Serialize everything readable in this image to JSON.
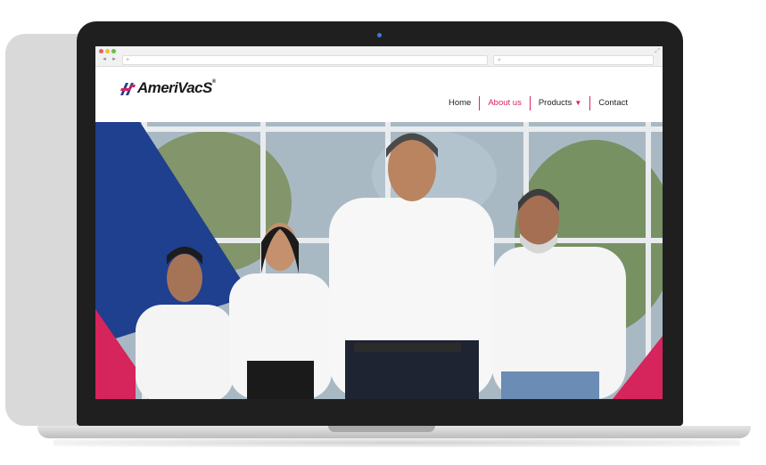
{
  "browser": {
    "back_icon": "back-arrow-icon",
    "forward_icon": "forward-arrow-icon",
    "url_placeholder": "+",
    "search_icon": "⌕"
  },
  "site": {
    "brand": "AmeriVacS",
    "brand_mark": "®",
    "nav": [
      {
        "label": "Home",
        "active": false
      },
      {
        "label": "About us",
        "active": true
      },
      {
        "label": "Products",
        "active": false,
        "has_dropdown": true
      },
      {
        "label": "Contact",
        "active": false
      }
    ],
    "accent_color": "#d6245c",
    "brand_blue": "#1f3f8f"
  },
  "hero": {
    "image": "team-photo-five-employees-white-shirts"
  }
}
